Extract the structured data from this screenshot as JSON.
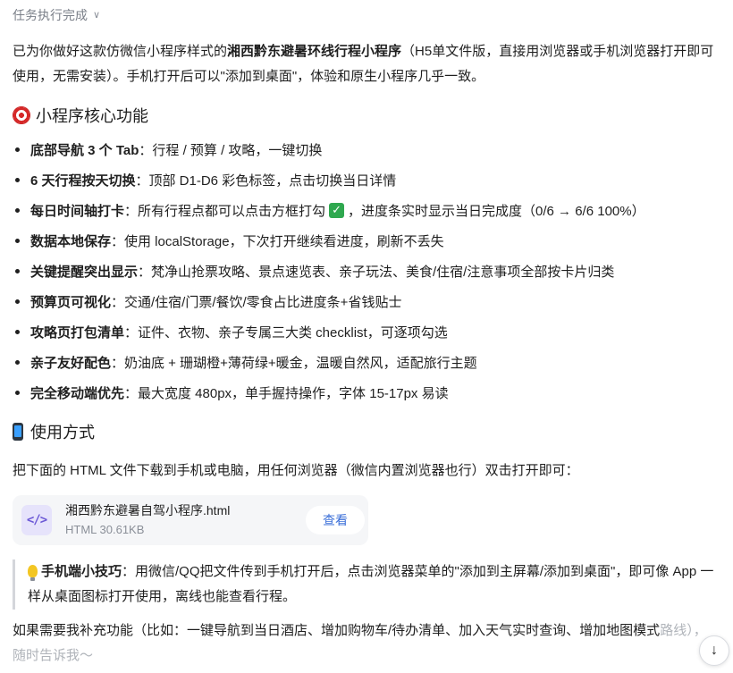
{
  "status": {
    "text": "任务执行完成",
    "chevron": "chevron-down-icon"
  },
  "intro": {
    "part1": "已为你做好这款仿微信小程序样式的",
    "bold": "湘西黔东避暑环线行程小程序",
    "part2": "（H5单文件版，直接用浏览器或手机浏览器打开即可使用，无需安装）。手机打开后可以\"添加到桌面\"，体验和原生小程序几乎一致。"
  },
  "core": {
    "heading": "小程序核心功能",
    "features": [
      {
        "title": "底部导航 3 个 Tab",
        "desc": "：行程 / 预算 / 攻略，一键切换"
      },
      {
        "title": "6 天行程按天切换",
        "desc": "：顶部 D1-D6 彩色标签，点击切换当日详情"
      },
      {
        "title": "每日时间轴打卡",
        "desc": "：所有行程点都可以点击方框打勾",
        "desc2": "，进度条实时显示当日完成度（0/6 → 6/6 100%）"
      },
      {
        "title": "数据本地保存",
        "desc": "：使用 localStorage，下次打开继续看进度，刷新不丢失"
      },
      {
        "title": "关键提醒突出显示",
        "desc": "：梵净山抢票攻略、景点速览表、亲子玩法、美食/住宿/注意事项全部按卡片归类"
      },
      {
        "title": "预算页可视化",
        "desc": "：交通/住宿/门票/餐饮/零食占比进度条+省钱贴士"
      },
      {
        "title": "攻略页打包清单",
        "desc": "：证件、衣物、亲子专属三大类 checklist，可逐项勾选"
      },
      {
        "title": "亲子友好配色",
        "desc": "：奶油底 + 珊瑚橙+薄荷绿+暖金，温暖自然风，适配旅行主题"
      },
      {
        "title": "完全移动端优先",
        "desc": "：最大宽度 480px，单手握持操作，字体 15-17px 易读"
      }
    ]
  },
  "usage": {
    "heading": "使用方式",
    "text": "把下面的 HTML 文件下载到手机或电脑，用任何浏览器（微信内置浏览器也行）双击打开即可："
  },
  "file": {
    "icon_text": "</>",
    "name": "湘西黔东避暑自驾小程序.html",
    "size": "HTML 30.61KB",
    "view_label": "查看"
  },
  "tip": {
    "bold": "手机端小技巧",
    "text": "：用微信/QQ把文件传到手机打开后，点击浏览器菜单的\"添加到主屏幕/添加到桌面\"，即可像 App 一样从桌面图标打开使用，离线也能查看行程。"
  },
  "closing": {
    "text": "如果需要我补充功能（比如：一键导航到当日酒店、增加购物车/待办清单、加入天气实时查询、增加地图模式",
    "fade": "路线），随时告诉我～"
  },
  "scroll": {
    "arrow": "↓"
  },
  "colors": {
    "text": "#1f1f1f",
    "muted": "#7a7f88",
    "link": "#3b6fd8",
    "file_icon": "#6b58d6",
    "file_card_bg": "#f5f6f8"
  }
}
